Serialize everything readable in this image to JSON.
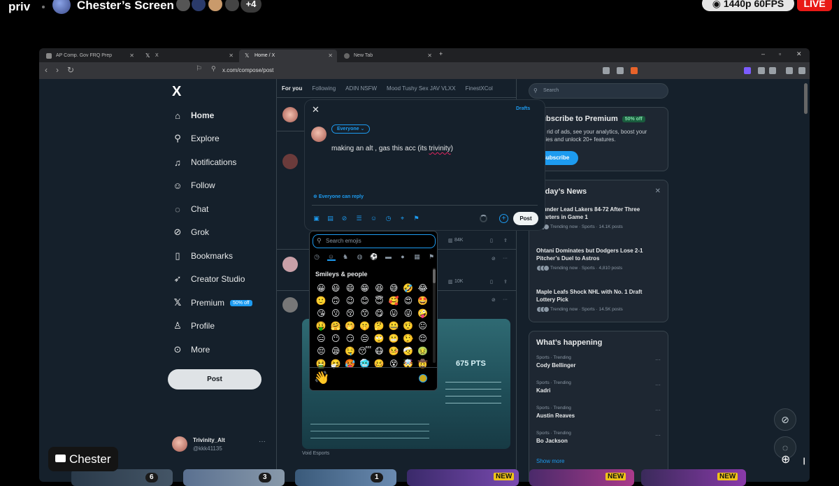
{
  "stream": {
    "channel": "priv",
    "screen_title": "Chester’s Screen",
    "viewer_extra": "+4",
    "quality": "1440p 60FPS",
    "live": "LIVE",
    "presenter": "Chester"
  },
  "browser": {
    "tabs": [
      {
        "label": "AP Comp. Gov FRQ Prep"
      },
      {
        "label": "X"
      },
      {
        "label": "Home / X"
      },
      {
        "label": "New Tab"
      }
    ],
    "url": "x.com/compose/post"
  },
  "sidebar": {
    "logo": "X",
    "items": [
      {
        "label": "Home"
      },
      {
        "label": "Explore"
      },
      {
        "label": "Notifications"
      },
      {
        "label": "Follow"
      },
      {
        "label": "Chat"
      },
      {
        "label": "Grok"
      },
      {
        "label": "Bookmarks"
      },
      {
        "label": "Creator Studio"
      },
      {
        "label": "Premium"
      },
      {
        "label": "Profile"
      },
      {
        "label": "More"
      }
    ],
    "premium_badge": "50% off",
    "post_label": "Post",
    "user_name": "Trivinity_Alt",
    "user_handle": "@kkk41135"
  },
  "feed": {
    "tabs": [
      "For you",
      "Following",
      "ADIN NSFW",
      "Mood Tushy Sex JAV VLXX",
      "FinestXCol"
    ],
    "views_1": "84K",
    "views_2": "10K",
    "card_score": "675 PTS",
    "card_source": "Void Esports"
  },
  "compose": {
    "drafts": "Drafts",
    "audience": "Everyone",
    "text_before": "making an alt , gas this acc (its ",
    "text_misspelled": "trivinity",
    "text_after": ")",
    "reply_setting": "Everyone can reply",
    "post_label": "Post"
  },
  "emoji": {
    "search_placeholder": "Search emojis",
    "category_title": "Smileys & people",
    "grid": [
      "😀",
      "😃",
      "😄",
      "😁",
      "😆",
      "😅",
      "🤣",
      "😂",
      "🙂",
      "🙃",
      "😉",
      "😊",
      "😇",
      "🥰",
      "😍",
      "🤩",
      "😘",
      "😗",
      "😚",
      "😙",
      "😋",
      "😛",
      "😜",
      "🤪",
      "🤑",
      "🤗",
      "🤭",
      "🤫",
      "🤔",
      "🤐",
      "🤨",
      "😐",
      "😑",
      "😶",
      "😏",
      "😒",
      "🙄",
      "😬",
      "🤥",
      "😌",
      "😔",
      "😪",
      "🤤",
      "😴",
      "😷",
      "🤒",
      "🤕",
      "🤢",
      "🤮",
      "🤧",
      "🥵",
      "🥶",
      "🥴",
      "😵",
      "🤯",
      "🤠"
    ],
    "preview": "👋"
  },
  "premium_panel": {
    "title": "Subscribe to Premium",
    "badge": "50% off",
    "body": "Get rid of ads, see your analytics, boost your replies and unlock 20+ features.",
    "button": "Subscribe"
  },
  "news_panel": {
    "title": "Today’s News",
    "items": [
      {
        "headline": "Thunder Lead Lakers 84-72 After Three Quarters in Game 1",
        "meta": "Trending now · Sports · 14.1K posts"
      },
      {
        "headline": "Ohtani Dominates but Dodgers Lose 2-1 Pitcher’s Duel to Astros",
        "meta": "Trending now · Sports · 4,810 posts"
      },
      {
        "headline": "Maple Leafs Shock NHL with No. 1 Draft Lottery Pick",
        "meta": "Trending now · Sports · 14.5K posts"
      }
    ]
  },
  "happening_panel": {
    "title": "What’s happening",
    "items": [
      {
        "category": "Sports · Trending",
        "name": "Cody Bellinger"
      },
      {
        "category": "Sports · Trending",
        "name": "Kadri"
      },
      {
        "category": "Sports · Trending",
        "name": "Austin Reaves"
      },
      {
        "category": "Sports · Trending",
        "name": "Bo Jackson"
      }
    ],
    "show_more": "Show more"
  },
  "search": {
    "placeholder": "Search"
  },
  "strip": {
    "new_badge": "NEW",
    "counts": [
      "6",
      "3",
      "1"
    ]
  },
  "colors": {
    "accent": "#1d9bf0",
    "background": "#15202b",
    "live": "#e91916"
  }
}
